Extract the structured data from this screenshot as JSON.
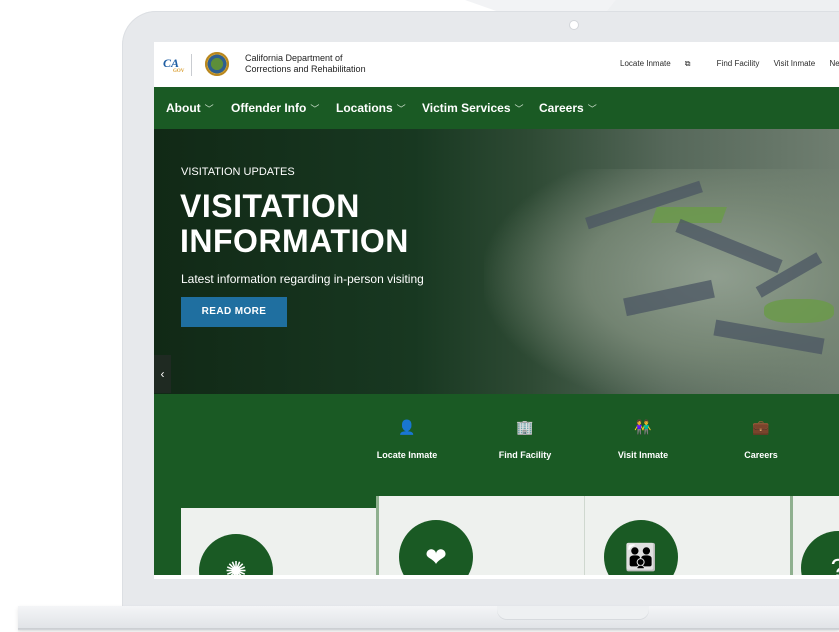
{
  "header": {
    "logo_text": "CA",
    "logo_sub": "GOV",
    "department_line1": "California Department of",
    "department_line2": "Corrections and Rehabilitation",
    "top_links": [
      "Locate Inmate",
      "Find Facility",
      "Visit Inmate",
      "Nev"
    ],
    "external_icon": "external-link-icon"
  },
  "nav": {
    "items": [
      "About",
      "Offender Info",
      "Locations",
      "Victim Services",
      "Careers"
    ],
    "chevron": "﹀"
  },
  "hero": {
    "eyebrow": "VISITATION UPDATES",
    "title_line1": "VISITATION",
    "title_line2": "INFORMATION",
    "description": "Latest information regarding in-person visiting",
    "button": "READ MORE",
    "prev_arrow": "‹"
  },
  "quick_links": [
    {
      "label": "Locate Inmate",
      "icon": "person-icon",
      "glyph": "👤"
    },
    {
      "label": "Find Facility",
      "icon": "building-icon",
      "glyph": "🏢"
    },
    {
      "label": "Visit Inmate",
      "icon": "people-icon",
      "glyph": "👫"
    },
    {
      "label": "Careers",
      "icon": "briefcase-icon",
      "glyph": "💼"
    }
  ],
  "cards": [
    {
      "icon": "virus-icon",
      "glyph": "✺"
    },
    {
      "icon": "heart-hand-icon",
      "glyph": "❤"
    },
    {
      "icon": "family-icon",
      "glyph": "👪"
    },
    {
      "icon": "question-icon",
      "glyph": "?"
    }
  ],
  "colors": {
    "brand_green": "#1a5a24",
    "button_blue": "#1f6fa0",
    "card_bg": "#eef1ee"
  }
}
